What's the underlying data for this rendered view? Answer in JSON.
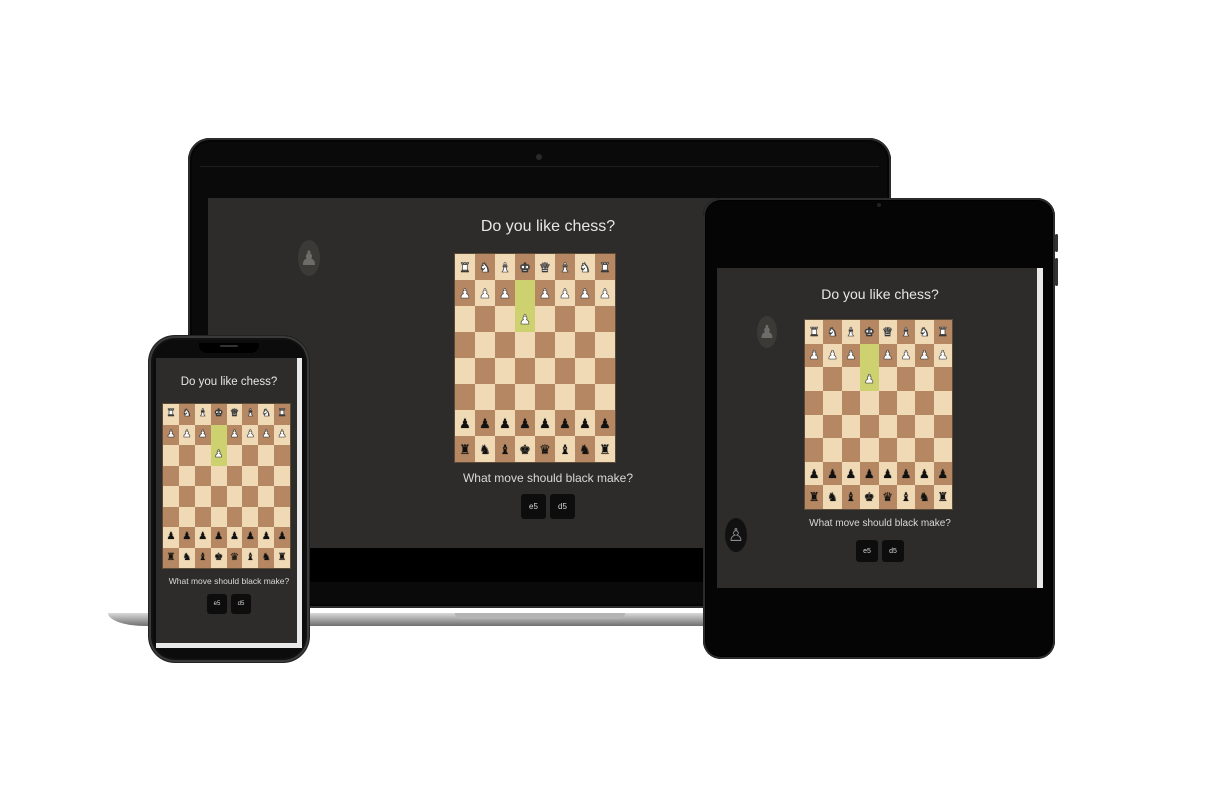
{
  "app": {
    "title": "Do you like chess?",
    "question": "What move should black make?",
    "moves": [
      "e5",
      "d5"
    ]
  },
  "board": {
    "highlight_squares": [
      "d2",
      "d3"
    ],
    "ranks": [
      [
        "wR",
        "wN",
        "wB",
        "wK",
        "wQ",
        "wB",
        "wN",
        "wR"
      ],
      [
        "wP",
        "wP",
        "wP",
        "",
        "wP",
        "wP",
        "wP",
        "wP"
      ],
      [
        "",
        "",
        "",
        "wP",
        "",
        "",
        "",
        ""
      ],
      [
        "",
        "",
        "",
        "",
        "",
        "",
        "",
        ""
      ],
      [
        "",
        "",
        "",
        "",
        "",
        "",
        "",
        ""
      ],
      [
        "",
        "",
        "",
        "",
        "",
        "",
        "",
        ""
      ],
      [
        "bP",
        "bP",
        "bP",
        "bP",
        "bP",
        "bP",
        "bP",
        "bP"
      ],
      [
        "bR",
        "bN",
        "bB",
        "bK",
        "bQ",
        "bB",
        "bN",
        "bR"
      ]
    ]
  },
  "icons": {
    "white_piece_set": "chess-piece-glyphs",
    "decorative_pawn": "pawn-icon"
  },
  "colors": {
    "light_square": "#f0d9b5",
    "dark_square": "#b58863",
    "highlight": "#cdd16f",
    "app_background": "#2d2c2a",
    "button_background": "#0d0d0d"
  }
}
